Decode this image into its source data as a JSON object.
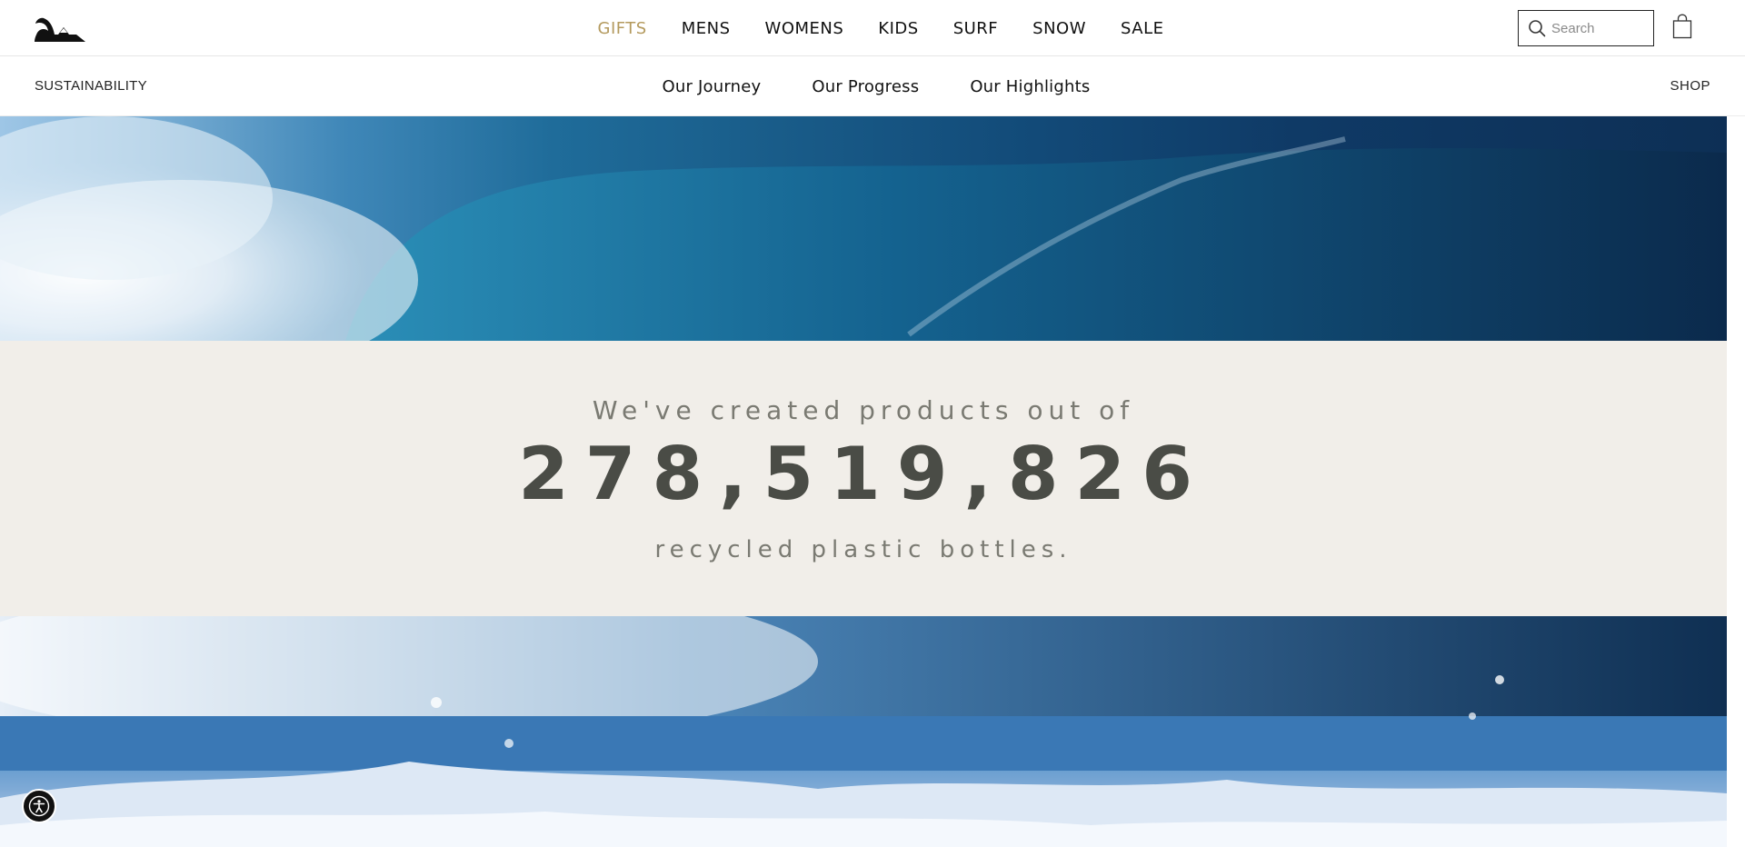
{
  "brand": {
    "logo_icon": "quiksilver-wave-mountain-logo"
  },
  "main_nav": {
    "items": [
      {
        "label": "GIFTS",
        "accent": "#b49a5e"
      },
      {
        "label": "MENS"
      },
      {
        "label": "WOMENS"
      },
      {
        "label": "KIDS"
      },
      {
        "label": "SURF"
      },
      {
        "label": "SNOW"
      },
      {
        "label": "SALE"
      }
    ]
  },
  "search": {
    "placeholder": "Search",
    "icon": "search-icon"
  },
  "cart": {
    "icon": "shopping-bag-icon"
  },
  "sub_header": {
    "title": "SUSTAINABILITY",
    "nav": [
      {
        "label": "Our Journey"
      },
      {
        "label": "Our Progress"
      },
      {
        "label": "Our Highlights"
      }
    ],
    "shop_label": "SHOP"
  },
  "stat": {
    "intro": "We've created products out of",
    "number": "278,519,826",
    "outro": "recycled plastic bottles."
  },
  "colors": {
    "accent_gold": "#b49a5e",
    "band_bg": "#f1eee9",
    "number_color": "#4a4c46"
  },
  "accessibility": {
    "icon": "accessibility-icon"
  }
}
